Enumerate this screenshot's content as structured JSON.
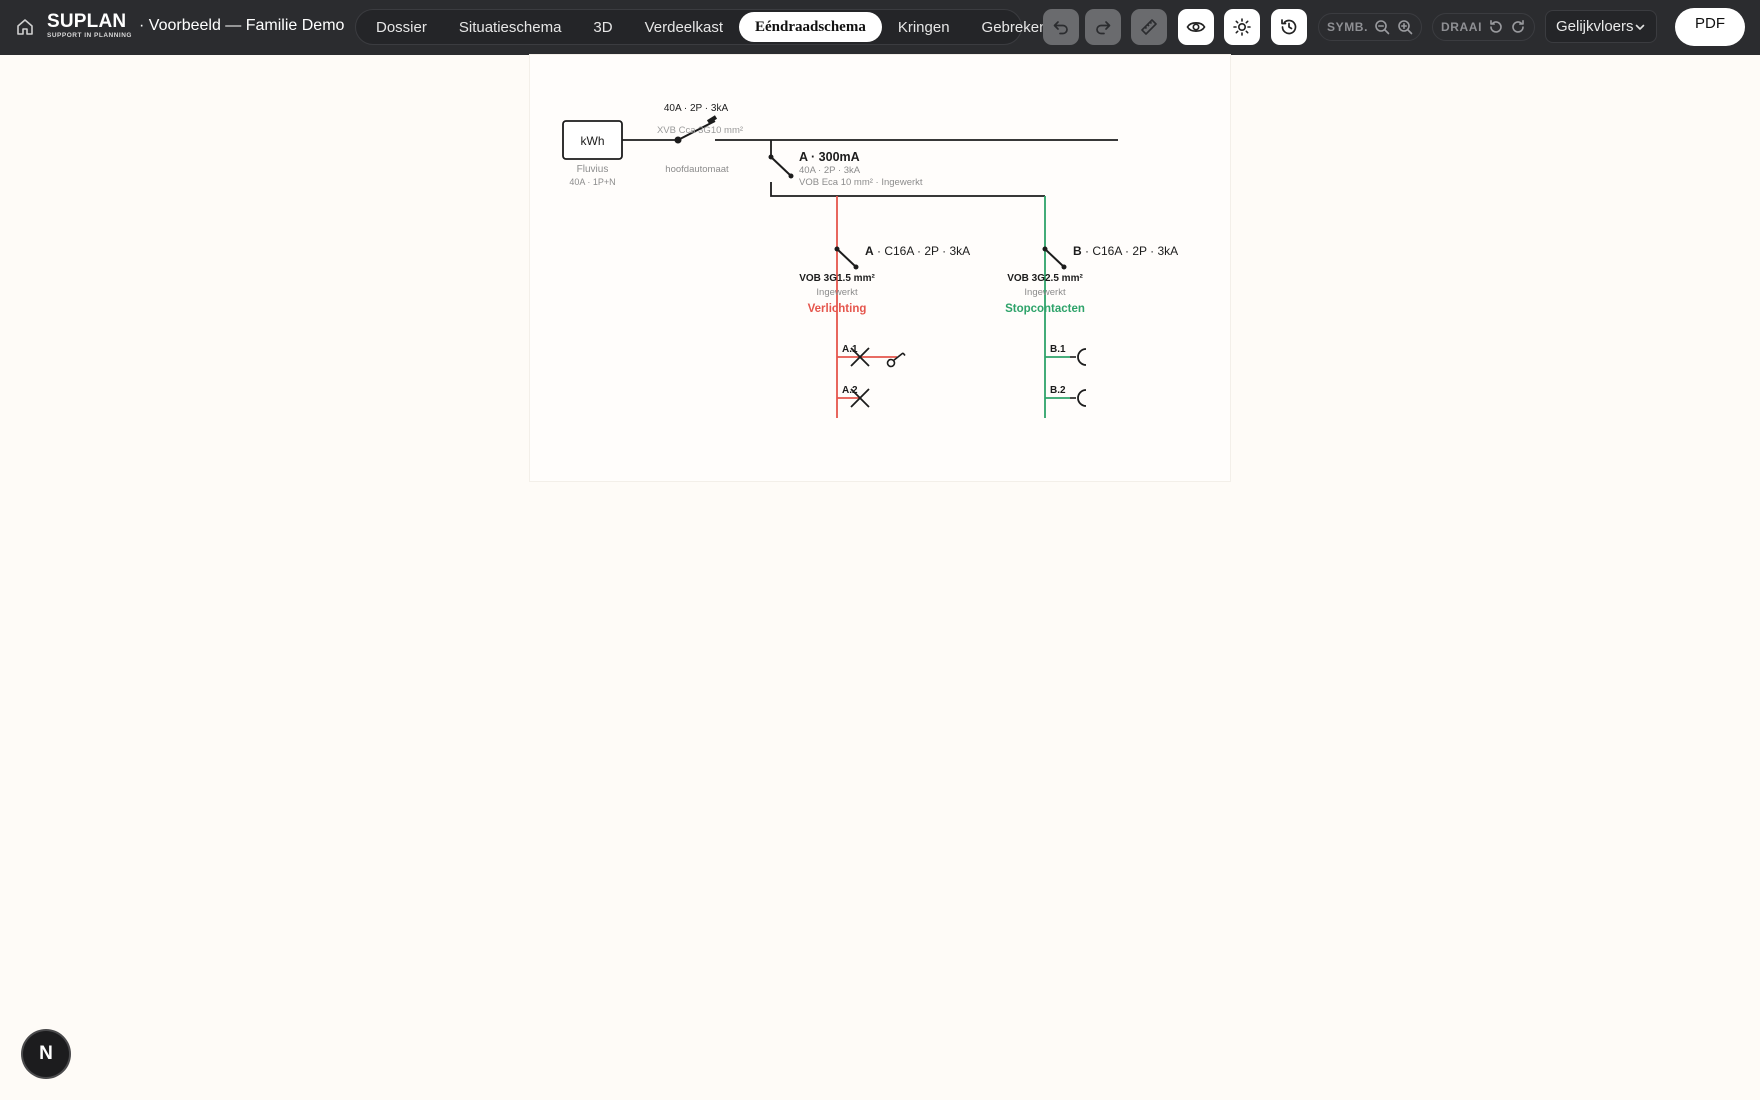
{
  "brand": {
    "name": "SUPLAN",
    "tagline": "SUPPORT IN PLANNING"
  },
  "document": {
    "title": "· Voorbeeld — Familie Demo"
  },
  "tabs": [
    {
      "label": "Dossier"
    },
    {
      "label": "Situatieschema"
    },
    {
      "label": "3D"
    },
    {
      "label": "Verdeelkast"
    },
    {
      "label": "Eéndraadschema",
      "active": true
    },
    {
      "label": "Kringen"
    },
    {
      "label": "Gebreken"
    }
  ],
  "toolbar": {
    "icons": [
      "undo-icon",
      "redo-icon",
      "ruler-icon",
      "eye-icon",
      "sun-icon",
      "history-icon"
    ],
    "symbol_label": "SYMB.",
    "rotate_label": "DRAAI",
    "floor_select": "Gelijkvloers",
    "pdf_label": "PDF"
  },
  "fab_label": "N",
  "colors": {
    "topbar": "#2b2c2f",
    "circuit_a": "#e5564d",
    "circuit_b": "#2ea36a",
    "accent": "#ffffff"
  },
  "diagram": {
    "meter": {
      "label": "kWh",
      "supplier": "Fluvius",
      "rating": "40A · 1P+N"
    },
    "main_breaker": {
      "rating": "40A · 2P · 3kA",
      "cable": "XVB Cca 3G10 mm²",
      "name": "hoofdautomaat"
    },
    "rcd": {
      "title": "A · 300mA",
      "rating": "40A · 2P · 3kA",
      "cable": "VOB Eca 10 mm² · Ingewerkt"
    },
    "circuits": [
      {
        "id": "A",
        "breaker": "C16A · 2P · 3kA",
        "cable": "VOB 3G1.5 mm²",
        "install": "Ingewerkt",
        "name": "Verlichting",
        "points": [
          {
            "label": "A.1"
          },
          {
            "label": "A.2"
          }
        ]
      },
      {
        "id": "B",
        "breaker": "C16A · 2P · 3kA",
        "cable": "VOB 3G2.5 mm²",
        "install": "Ingewerkt",
        "name": "Stopcontacten",
        "points": [
          {
            "label": "B.1"
          },
          {
            "label": "B.2"
          }
        ]
      }
    ]
  }
}
